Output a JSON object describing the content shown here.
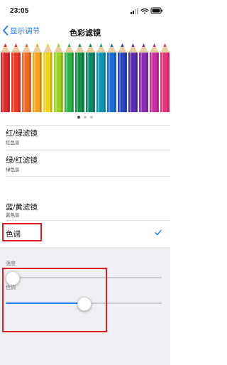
{
  "status_bar": {
    "time": "23:05",
    "icons": [
      "signal-icon",
      "wifi-icon",
      "battery-icon"
    ]
  },
  "nav": {
    "back_label": "显示调节",
    "title": "色彩滤镜"
  },
  "pencils": {
    "colors": [
      "#d92b2b",
      "#e83c2a",
      "#f06a25",
      "#f4a323",
      "#f2d21c",
      "#9fd12a",
      "#2fb44a",
      "#1c8f4d",
      "#12876b",
      "#1197b5",
      "#1a6fd1",
      "#2a46bf",
      "#5a2fb0",
      "#8a2db0",
      "#c7309c",
      "#e2367c"
    ]
  },
  "page_indicator": {
    "count": 3,
    "active": 0
  },
  "filters": [
    {
      "title": "红/绿滤镜",
      "subtitle": "红色盲"
    },
    {
      "title": "绿/红滤镜",
      "subtitle": "绿色盲"
    },
    {
      "title": "蓝/黄滤镜",
      "subtitle": "蓝色盲"
    }
  ],
  "selected_filter": {
    "label": "色调",
    "checked": true
  },
  "sliders": {
    "intensity": {
      "label": "强度",
      "value_fraction": 0.03
    },
    "hue": {
      "label": "色调",
      "value_fraction": 0.5
    }
  },
  "colors": {
    "accent": "#1a7af5",
    "highlight_box": "#e02020",
    "panel_background": "#efeff4"
  }
}
